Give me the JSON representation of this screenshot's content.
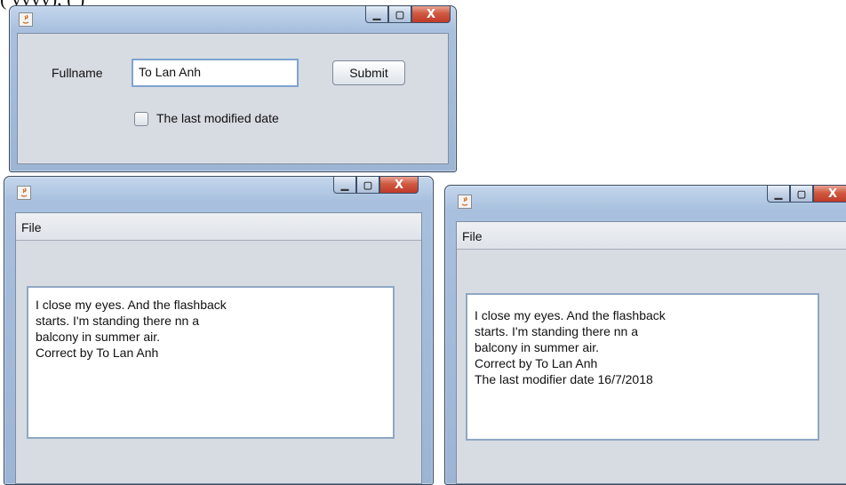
{
  "background_text": "(           yyyy),                   (           )",
  "window1": {
    "icon": "java-app-icon",
    "controls": {
      "minimize": "minimize-icon",
      "maximize": "maximize-icon",
      "close": "close-icon",
      "close_label": "X"
    },
    "fullname_label": "Fullname",
    "fullname_value": "To Lan Anh",
    "submit_label": "Submit",
    "checkbox_label": "The last modified date",
    "checkbox_checked": false
  },
  "window2": {
    "icon": "java-app-icon",
    "close_label": "X",
    "menu_file": "File",
    "text_lines": [
      "I close my eyes. And the flashback",
      "starts. I'm standing there nn a",
      "balcony in summer air.",
      "Correct by To Lan Anh"
    ]
  },
  "window3": {
    "icon": "java-app-icon",
    "close_label": "X",
    "menu_file": "File",
    "text_lines": [
      "I close my eyes. And the flashback",
      "starts. I'm standing there nn a",
      "balcony in summer air.",
      "Correct by To Lan Anh",
      "The last modifier date 16/7/2018"
    ]
  },
  "colors": {
    "title_blue": "#a8c0de",
    "client_bg": "#d7dbe2",
    "close_red": "#c0392b"
  }
}
